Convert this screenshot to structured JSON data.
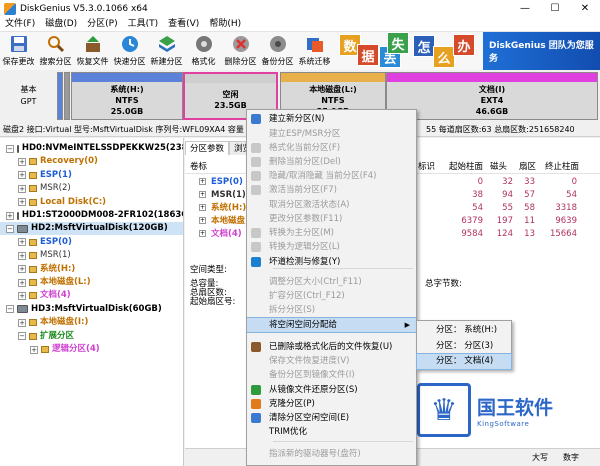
{
  "window": {
    "title": "DiskGenius V5.3.0.1066 x64",
    "controls": [
      "—",
      "☐",
      "✕"
    ]
  },
  "menu": [
    "文件(F)",
    "磁盘(D)",
    "分区(P)",
    "工具(T)",
    "查看(V)",
    "帮助(H)"
  ],
  "toolbar": [
    {
      "label": "保存更改",
      "icon": "save-icon"
    },
    {
      "label": "搜索分区",
      "icon": "search-partition-icon"
    },
    {
      "label": "恢复文件",
      "icon": "recover-file-icon"
    },
    {
      "label": "快速分区",
      "icon": "quick-partition-icon"
    },
    {
      "label": "新建分区",
      "icon": "new-partition-icon"
    },
    {
      "label": "格式化",
      "icon": "format-icon"
    },
    {
      "label": "删除分区",
      "icon": "delete-partition-icon"
    },
    {
      "label": "备份分区",
      "icon": "backup-partition-icon"
    },
    {
      "label": "系统迁移",
      "icon": "migrate-icon"
    }
  ],
  "banner": {
    "tiles": [
      "数",
      "据",
      "丢",
      "失",
      "怎",
      "么",
      "办"
    ],
    "text": "DiskGenius 团队为您服务",
    "subtext": ""
  },
  "diskmap": {
    "basic_label": "基本",
    "style_label": "GPT",
    "partitions": [
      {
        "name": "系统(H:)",
        "fs": "NTFS",
        "size": "25.0GB",
        "color": "#5b82d8"
      },
      {
        "name": "空闲",
        "fs": "",
        "size": "23.5GB",
        "color": "#d9d9d9"
      },
      {
        "name": "本地磁盘(L:)",
        "fs": "NTFS",
        "size": "25.0GB",
        "color": "#e8b04a"
      },
      {
        "name": "文档(I)",
        "fs": "EXT4",
        "size": "46.6GB",
        "color": "#e040e0"
      }
    ]
  },
  "diskinfo": {
    "left": "磁盘2 接口:Virtual  型号:MsftVirtualDisk  序列号:WFL09XA4  容量",
    "right": "55  每道扇区数:63  总扇区数:251658240"
  },
  "tree": [
    {
      "label": "HD0:NVMeINTELSSDPEKKW25(238GB)",
      "color": "#000",
      "bold": true,
      "expander": "−"
    },
    {
      "label": "Recovery(0)",
      "color": "#c07000",
      "bold": true,
      "expander": "+"
    },
    {
      "label": "ESP(1)",
      "color": "#1d5cd9",
      "bold": true,
      "expander": "+"
    },
    {
      "label": "MSR(2)",
      "color": "#333",
      "bold": false,
      "expander": "+"
    },
    {
      "label": "Local Disk(C:)",
      "color": "#c07000",
      "bold": true,
      "expander": "+"
    },
    {
      "label": "HD1:ST2000DM008-2FR102(1863GB)",
      "color": "#000",
      "bold": true,
      "expander": "+"
    },
    {
      "label": "HD2:MsftVirtualDisk(120GB)",
      "color": "#000",
      "bold": true,
      "expander": "−"
    },
    {
      "label": "ESP(0)",
      "color": "#1d5cd9",
      "bold": true,
      "expander": "+"
    },
    {
      "label": "MSR(1)",
      "color": "#333",
      "bold": false,
      "expander": "+"
    },
    {
      "label": "系统(H:)",
      "color": "#c07000",
      "bold": true,
      "expander": "+"
    },
    {
      "label": "本地磁盘(L:)",
      "color": "#c07000",
      "bold": true,
      "expander": "+"
    },
    {
      "label": "文档(4)",
      "color": "#d040d0",
      "bold": true,
      "expander": "+"
    },
    {
      "label": "HD3:MsftVirtualDisk(60GB)",
      "color": "#000",
      "bold": true,
      "expander": "−"
    },
    {
      "label": "本地磁盘(I:)",
      "color": "#c07000",
      "bold": true,
      "expander": "+"
    },
    {
      "label": "扩展分区",
      "color": "#1a8a1a",
      "bold": true,
      "expander": "−"
    },
    {
      "label": "逻辑分区(4)",
      "color": "#d040d0",
      "bold": true,
      "expander": "+"
    }
  ],
  "tabs": [
    "分区参数",
    "浏览"
  ],
  "rlist": {
    "header": [
      "卷标",
      "",
      "标识",
      "起始柱面",
      "磁头",
      "扇区",
      "终止柱面"
    ],
    "rows": [
      {
        "name": "ESP(0)",
        "color": "#1d5cd9",
        "cyl_start": "0",
        "head": "32",
        "sector": "33",
        "cyl_end": "0"
      },
      {
        "name": "MSR(1)",
        "color": "#333",
        "cyl_start": "38",
        "head": "94",
        "sector": "57",
        "cyl_end": "54"
      },
      {
        "name": "系统(H:)",
        "color": "#c07000",
        "cyl_start": "54",
        "head": "55",
        "sector": "58",
        "cyl_end": "3318"
      },
      {
        "name": "本地磁盘",
        "color": "#c07000",
        "cyl_start": "6379",
        "head": "197",
        "sector": "11",
        "cyl_end": "9639"
      },
      {
        "name": "文档(4)",
        "color": "#d040d0",
        "cyl_start": "9584",
        "head": "124",
        "sector": "13",
        "cyl_end": "15664"
      }
    ]
  },
  "details": {
    "type_label": "空间类型:",
    "capacity_label": "总容量:",
    "sectors_label": "总扇区数:",
    "start_sector_label": "起始扇区号:",
    "bytes_label": "总字节数:"
  },
  "bottom": {
    "left": "大写",
    "right": "数字"
  },
  "context_menu": [
    {
      "label": "建立新分区(N)",
      "disabled": false,
      "icon": "new-partition-icon"
    },
    {
      "label": "建立ESP/MSR分区",
      "disabled": true,
      "icon": ""
    },
    {
      "label": "格式化当前分区(F)",
      "disabled": true,
      "icon": "format-icon"
    },
    {
      "label": "删除当前分区(Del)",
      "disabled": true,
      "icon": "delete-icon"
    },
    {
      "label": "隐藏/取消隐藏 当前分区(F4)",
      "disabled": true,
      "icon": "hide-icon"
    },
    {
      "label": "激活当前分区(F7)",
      "disabled": true,
      "icon": "activate-icon"
    },
    {
      "label": "取消分区激活状态(A)",
      "disabled": true,
      "icon": ""
    },
    {
      "label": "更改分区参数(F11)",
      "disabled": true,
      "icon": ""
    },
    {
      "label": "转换为主分区(M)",
      "disabled": true,
      "icon": "convert-primary-icon"
    },
    {
      "label": "转换为逻辑分区(L)",
      "disabled": true,
      "icon": "convert-logical-icon"
    },
    {
      "label": "坏道检测与修复(Y)",
      "disabled": false,
      "icon": "badblock-icon"
    },
    {
      "label": "调整分区大小(Ctrl_F11)",
      "disabled": true,
      "icon": ""
    },
    {
      "label": "扩容分区(Ctrl_F12)",
      "disabled": true,
      "icon": ""
    },
    {
      "label": "拆分分区(S)",
      "disabled": true,
      "icon": ""
    },
    {
      "label": "将空闲空间分配给",
      "disabled": false,
      "icon": "",
      "submenu": true
    },
    {
      "label": "已删除或格式化后的文件恢复(U)",
      "disabled": false,
      "icon": "recover-file-icon"
    },
    {
      "label": "保存文件恢复进度(V)",
      "disabled": true,
      "icon": ""
    },
    {
      "label": "备份分区到镜像文件(I)",
      "disabled": true,
      "icon": ""
    },
    {
      "label": "从镜像文件还原分区(S)",
      "disabled": false,
      "icon": "restore-image-icon"
    },
    {
      "label": "克隆分区(P)",
      "disabled": false,
      "icon": "clone-icon"
    },
    {
      "label": "清除分区空闲空间(E)",
      "disabled": false,
      "icon": "wipe-icon"
    },
    {
      "label": "TRIM优化",
      "disabled": false,
      "icon": ""
    },
    {
      "label": "指派新的驱动器号(盘符)",
      "disabled": true,
      "icon": ""
    }
  ],
  "submenu": [
    {
      "label": "分区： 系统(H:)",
      "highlight": false
    },
    {
      "label": "分区： 分区(3)",
      "highlight": false
    },
    {
      "label": "分区： 文档(4)",
      "highlight": true
    }
  ],
  "watermark": {
    "title": "国王软件",
    "subtitle": "KingSoftware",
    "crown": "♛"
  }
}
